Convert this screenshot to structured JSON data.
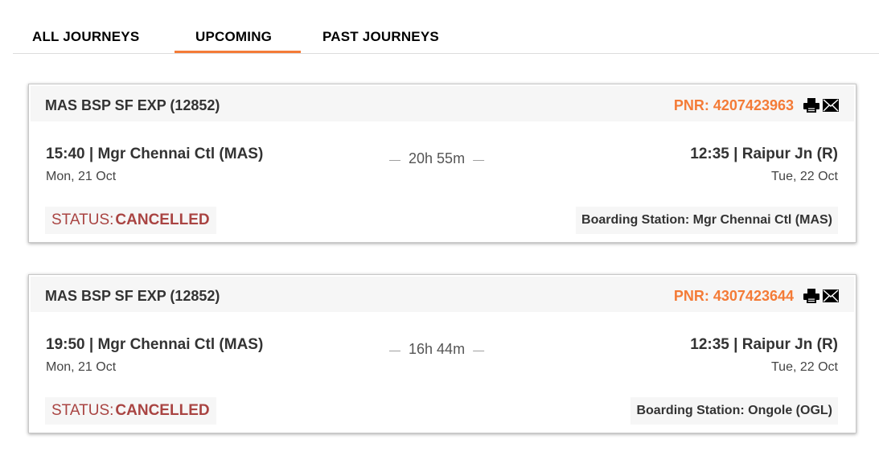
{
  "tabs": [
    {
      "label": "ALL JOURNEYS"
    },
    {
      "label": "UPCOMING",
      "active": true
    },
    {
      "label": "PAST JOURNEYS"
    }
  ],
  "colors": {
    "accent": "#f47b37",
    "status": "#a94442"
  },
  "journeys": [
    {
      "train": "MAS BSP SF EXP (12852)",
      "pnr": "PNR: 4207423963",
      "departure": {
        "time_station": "15:40 | Mgr Chennai Ctl (MAS)",
        "date": "Mon, 21 Oct"
      },
      "duration": "20h 55m",
      "arrival": {
        "time_station": "12:35 | Raipur Jn (R)",
        "date": "Tue, 22 Oct"
      },
      "status_label": "STATUS:",
      "status_value": "CANCELLED",
      "boarding": "Boarding Station: Mgr Chennai Ctl (MAS)",
      "icons": [
        "print-icon",
        "mail-icon"
      ]
    },
    {
      "train": "MAS BSP SF EXP (12852)",
      "pnr": "PNR: 4307423644",
      "departure": {
        "time_station": "19:50 | Mgr Chennai Ctl (MAS)",
        "date": "Mon, 21 Oct"
      },
      "duration": "16h 44m",
      "arrival": {
        "time_station": "12:35 | Raipur Jn (R)",
        "date": "Tue, 22 Oct"
      },
      "status_label": "STATUS:",
      "status_value": "CANCELLED",
      "boarding": "Boarding Station: Ongole (OGL)",
      "icons": [
        "print-icon",
        "mail-icon"
      ]
    }
  ]
}
